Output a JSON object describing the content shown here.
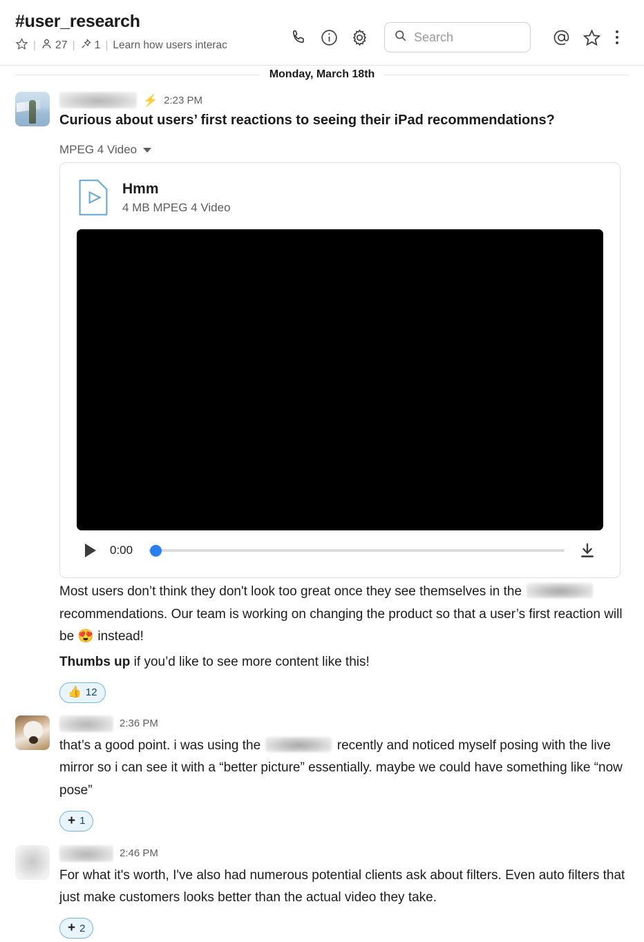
{
  "header": {
    "channel_name": "#user_research",
    "star_icon": "star-outline-icon",
    "members_icon": "person-icon",
    "members_count": "27",
    "pins_icon": "pin-icon",
    "pins_count": "1",
    "topic": "Learn how users interac",
    "call_icon": "phone-icon",
    "info_icon": "info-circle-icon",
    "settings_icon": "gear-icon",
    "search": {
      "icon": "search-icon",
      "placeholder": "Search",
      "value": ""
    },
    "mentions_icon": "at-mention-icon",
    "saved_icon": "star-outline-icon",
    "more_icon": "kebab-menu-icon"
  },
  "date_divider": "Monday, March 18th",
  "messages": [
    {
      "avatar": "lake-photo-avatar",
      "author": "[redacted]",
      "bolt_icon": "lightning-bolt-icon",
      "timestamp": "2:23 PM",
      "headline": "Curious about users’ first reactions to seeing their iPad recommendations?",
      "file_type_label": "MPEG 4 Video",
      "file": {
        "icon": "video-file-icon",
        "name": "Hmm",
        "meta": "4 MB MPEG 4 Video"
      },
      "player": {
        "play_icon": "play-icon",
        "current_time": "0:00",
        "progress_percent": 0,
        "download_icon": "download-icon"
      },
      "body_part1": "Most users don’t think they don't look too great once they see themselves in the",
      "body_redacted": "[redacted]",
      "body_part2": "recommendations. Our team is working on changing the product so that a user’s first reaction will be",
      "body_emoji": "😍",
      "body_part3": "instead!",
      "cta_bold": "Thumbs up",
      "cta_rest": "if you’d like to see more content like this!",
      "reactions": [
        {
          "icon": "thumbs-up-emoji",
          "emoji": "👍",
          "count": "12"
        }
      ]
    },
    {
      "avatar": "dog-photo-avatar",
      "author": "[redacted]",
      "timestamp": "2:36 PM",
      "text_part1": "that’s a good point. i was using the",
      "text_redacted": "[redacted]",
      "text_part2": "recently and noticed myself posing with the live mirror so i can see it with a “better picture” essentially. maybe we could have something like “now pose”",
      "reactions": [
        {
          "icon": "add-reaction-icon",
          "emoji": "+",
          "count": "1"
        }
      ]
    },
    {
      "avatar": "blurred-avatar",
      "author": "[redacted]",
      "timestamp": "2:46 PM",
      "text": "For what it's worth, I've also had numerous potential clients ask about filters. Even auto filters that just make customers looks better than the actual video they take.",
      "reactions": [
        {
          "icon": "add-reaction-icon",
          "emoji": "+",
          "count": "2"
        }
      ]
    }
  ],
  "colors": {
    "accent_blue": "#1264a3",
    "reaction_bg": "#e8f5fc",
    "reaction_border": "#74b4e6",
    "scrubber": "#2a7ff0",
    "file_icon": "#6aa9d8",
    "bolt": "#f2c12e"
  }
}
